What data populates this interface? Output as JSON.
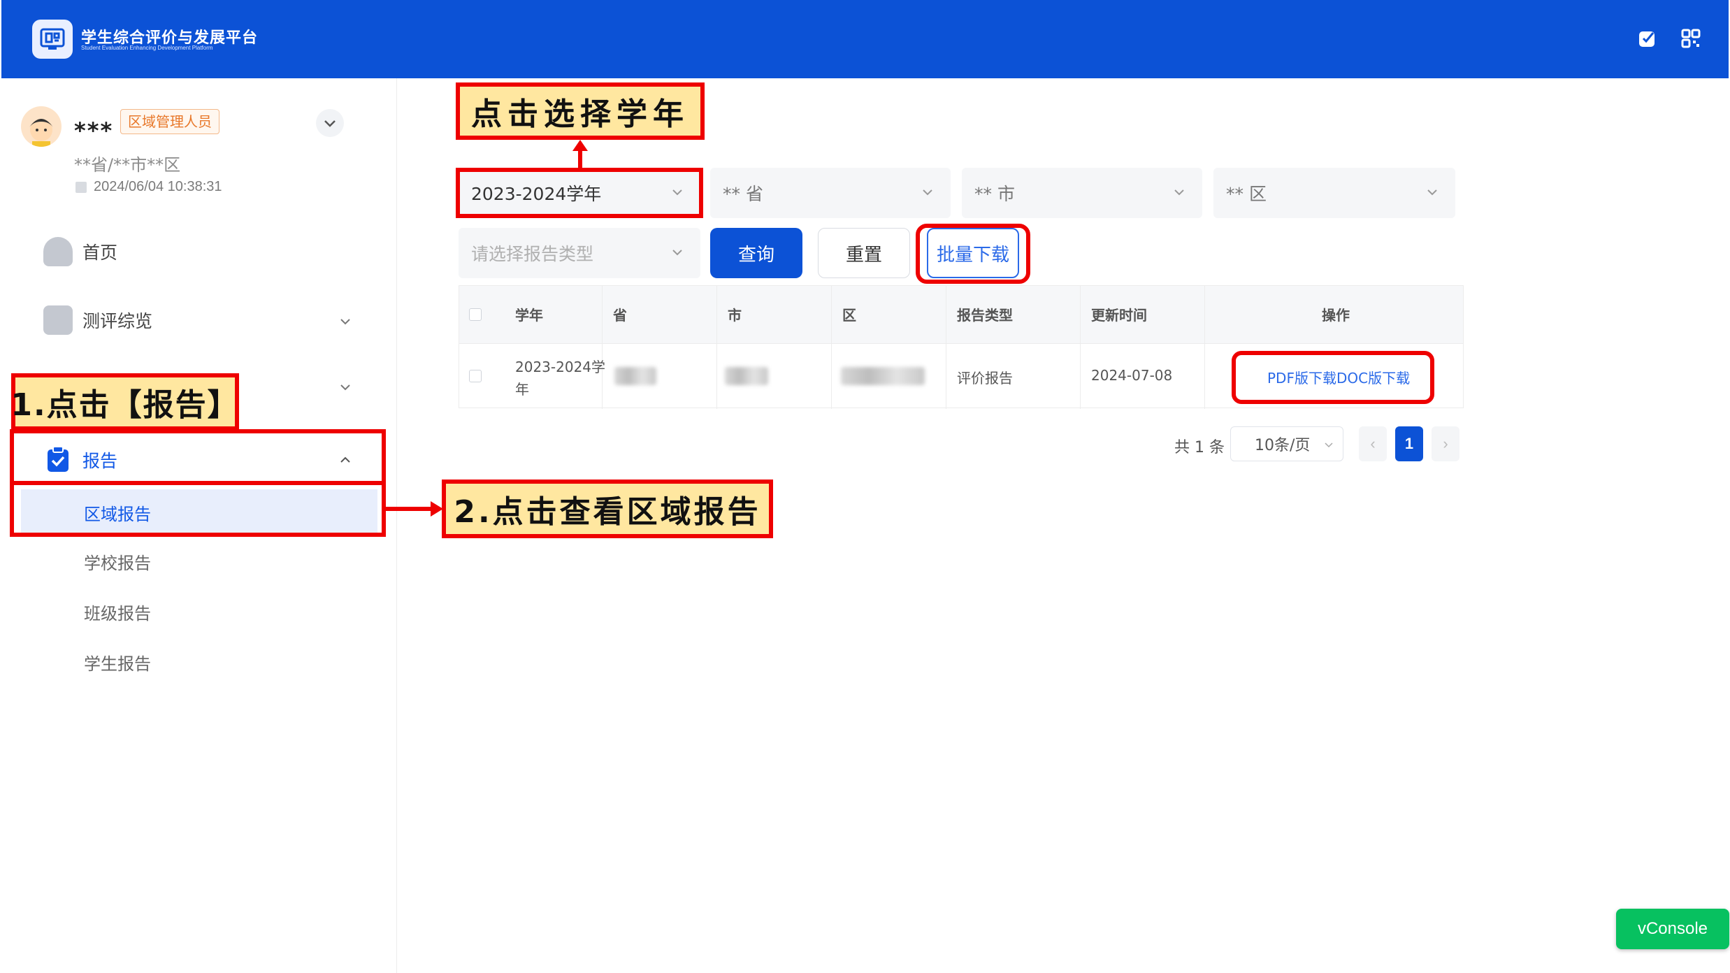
{
  "header": {
    "title": "学生综合评价与发展平台",
    "subtitle": "Student Evaluation Enhancing Development Platform"
  },
  "user": {
    "name": "***",
    "role": "区域管理人员",
    "region": "**省/**市**区",
    "login_time": "2024/06/04 10:38:31"
  },
  "sidebar": {
    "items": [
      {
        "label": "首页"
      },
      {
        "label": "测评综览"
      },
      {
        "label": "报告"
      }
    ],
    "report_sub": [
      {
        "label": "区域报告"
      },
      {
        "label": "学校报告"
      },
      {
        "label": "班级报告"
      },
      {
        "label": "学生报告"
      }
    ]
  },
  "filters": {
    "year": "2023-2024学年",
    "province": "** 省",
    "city": "** 市",
    "district": "** 区",
    "report_type_placeholder": "请选择报告类型",
    "query_label": "查询",
    "reset_label": "重置",
    "batch_download_label": "批量下载"
  },
  "table": {
    "headers": [
      "学年",
      "省",
      "市",
      "区",
      "报告类型",
      "更新时间",
      "操作"
    ],
    "rows": [
      {
        "year_line1": "2023-2024学",
        "year_line2": "年",
        "report_type": "评价报告",
        "updated": "2024-07-08",
        "pdf_label": "PDF版下载",
        "doc_label": "DOC版下载"
      }
    ]
  },
  "pagination": {
    "total": "共 1 条",
    "page_size": "10条/页",
    "current": "1"
  },
  "annotations": {
    "step1": "1.点击【报告】",
    "step2": "2.点击查看区域报告",
    "select_year": "点击选择学年"
  },
  "vconsole_label": "vConsole",
  "colors": {
    "header_bg": "#0c52d6",
    "primary": "#0c52d6",
    "annotation_red": "#ee0000",
    "annotation_fill": "#ffe7a0",
    "vconsole": "#07c160"
  }
}
